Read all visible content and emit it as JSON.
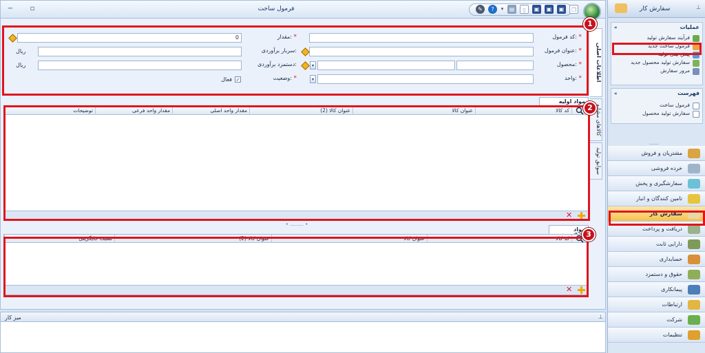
{
  "window": {
    "title": "فرمول ساخت",
    "minimize_glyph": "−",
    "restore_glyph": "▫"
  },
  "tabs": {
    "main_info": "اطلاعات اصلی",
    "tab2": "کالاهای مشابه",
    "tab3": "سوابق تولید"
  },
  "form": {
    "code_label": "کد فرمول:",
    "title_label": "عنوان فرمول:",
    "product_label": "محصول:",
    "unit_label": "واحد:",
    "quantity_label": "مقدار:",
    "overhead_label": "سربار برآوردی:",
    "wage_label": "دستمزد برآوردی:",
    "status_label": "وضعیت:",
    "required_mark": "*",
    "quantity_value": "0",
    "currency_unit_1": "ریال",
    "currency_unit_2": "ریال",
    "active_label": "فعال",
    "active_checked": "✓"
  },
  "raw_materials": {
    "tab_label": "مواد اولیه",
    "columns": [
      "کد کالا",
      "عنوان کالا",
      "عنوان کالا (2)",
      "مقدار واحد اصلی",
      "مقدار واحد فرعی",
      "توضیحات"
    ]
  },
  "substitutes": {
    "tab_label": "مواد جایگزین",
    "columns": [
      "کد کالا",
      "عنوان کالا",
      "عنوان کالا (2)",
      "نسبت جایگزینی"
    ]
  },
  "badges": [
    "1",
    "2",
    "3"
  ],
  "splitter_dots": "• ......... •",
  "desk": {
    "title": "میز کار"
  },
  "nav": {
    "title": "سفارش کار",
    "operations_title": "عملیات",
    "operations": [
      "فرآیند سفارش تولید",
      "فرمول ساخت جدید",
      "پیش بینی تولید",
      "سفارش تولید محصول جدید",
      "مرور سفارش"
    ],
    "lists_title": "فهرست",
    "lists": [
      "فرمول ساخت",
      "سفارش تولید محصول"
    ],
    "grip": "......",
    "modules": [
      "مشتریان و فروش",
      "خرده فروشی",
      "سفارشگیری و پخش",
      "تامین کنندگان و انبار",
      "سفارش کار",
      "دریافت و پرداخت",
      "دارایی ثابت",
      "حسابداری",
      "حقوق و دستمزد",
      "پیمانکاری",
      "ارتباطات",
      "شرکت",
      "تنظیمات"
    ]
  },
  "colors": {
    "highlight_red": "#e0141e",
    "accent_blue": "#1b3766",
    "active_module": "#f4c24f"
  }
}
